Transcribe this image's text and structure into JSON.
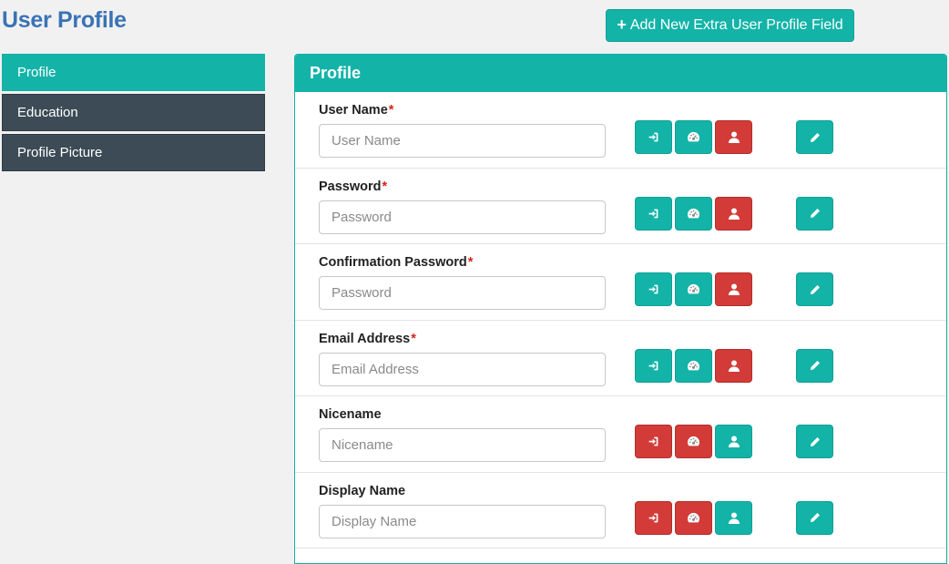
{
  "page": {
    "title": "User Profile"
  },
  "toolbar": {
    "add_field_label": "Add New Extra User Profile Field",
    "add_icon": "plus-icon"
  },
  "sidebar": {
    "items": [
      {
        "label": "Profile",
        "active": true
      },
      {
        "label": "Education",
        "active": false
      },
      {
        "label": "Profile Picture",
        "active": false
      }
    ]
  },
  "panel": {
    "title": "Profile",
    "fields": [
      {
        "label": "User Name",
        "required": "*",
        "placeholder": "User Name",
        "value": "",
        "states": [
          "teal",
          "teal",
          "red"
        ]
      },
      {
        "label": "Password",
        "required": "*",
        "placeholder": "Password",
        "value": "",
        "states": [
          "teal",
          "teal",
          "red"
        ]
      },
      {
        "label": "Confirmation Password",
        "required": "*",
        "placeholder": "Password",
        "value": "",
        "states": [
          "teal",
          "teal",
          "red"
        ]
      },
      {
        "label": "Email Address",
        "required": "*",
        "placeholder": "Email Address",
        "value": "",
        "states": [
          "teal",
          "teal",
          "red"
        ]
      },
      {
        "label": "Nicename",
        "required": "",
        "placeholder": "Nicename",
        "value": "",
        "states": [
          "red",
          "red",
          "teal"
        ]
      },
      {
        "label": "Display Name",
        "required": "",
        "placeholder": "Display Name",
        "value": "",
        "states": [
          "red",
          "red",
          "teal"
        ]
      }
    ],
    "row_icons": [
      "sign-in-icon",
      "dashboard-icon",
      "user-icon",
      "pencil-icon"
    ]
  },
  "colors": {
    "teal": "#14b3a8",
    "red": "#d23b38",
    "dark": "#3c4b55",
    "title_blue": "#3a73b5"
  }
}
